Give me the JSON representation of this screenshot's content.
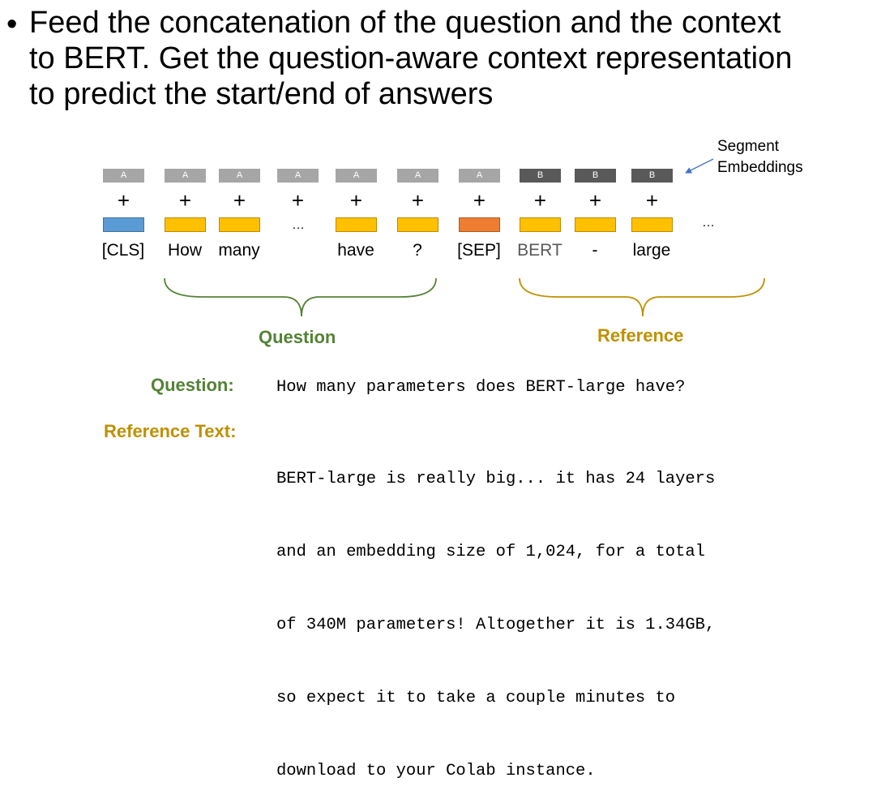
{
  "bullet": {
    "symbol": "•",
    "lines": [
      "Feed the concatenation of the question and the context",
      "to BERT. Get the question-aware context representation",
      "to predict the start/end of answers"
    ]
  },
  "diagram": {
    "segment_label_lines": [
      "Segment",
      "Embeddings"
    ],
    "plus": "+",
    "ellipsis": "…",
    "tokens": [
      {
        "segment": "A",
        "word": "[CLS]",
        "color": "#5b9bd5"
      },
      {
        "segment": "A",
        "word": "How",
        "color": "#ffc000"
      },
      {
        "segment": "A",
        "word": "many",
        "color": "#ffc000"
      },
      {
        "segment": "A",
        "word": "",
        "color": ""
      },
      {
        "segment": "A",
        "word": "have",
        "color": "#ffc000"
      },
      {
        "segment": "A",
        "word": "?",
        "color": "#ffc000"
      },
      {
        "segment": "A",
        "word": "[SEP]",
        "color": "#ed7d31"
      },
      {
        "segment": "B",
        "word": "BERT",
        "color": "#ffc000"
      },
      {
        "segment": "B",
        "word": "-",
        "color": "#ffc000"
      },
      {
        "segment": "B",
        "word": "large",
        "color": "#ffc000"
      }
    ],
    "question_brace_label": "Question",
    "reference_brace_label": "Reference",
    "colors": {
      "question": "#548235",
      "reference": "#bf9000",
      "segment_a": "#a6a6a6",
      "segment_b": "#595959"
    }
  },
  "qa": {
    "question_label": "Question:",
    "question_text": "How many parameters does BERT-large have?",
    "reference_label": "Reference Text:",
    "reference_lines": [
      "BERT-large is really big... it has 24 layers",
      "and an embedding size of 1,024, for a total",
      "of 340M parameters! Altogether it is 1.34GB,",
      "so expect it to take a couple minutes to",
      "download to your Colab instance."
    ]
  }
}
